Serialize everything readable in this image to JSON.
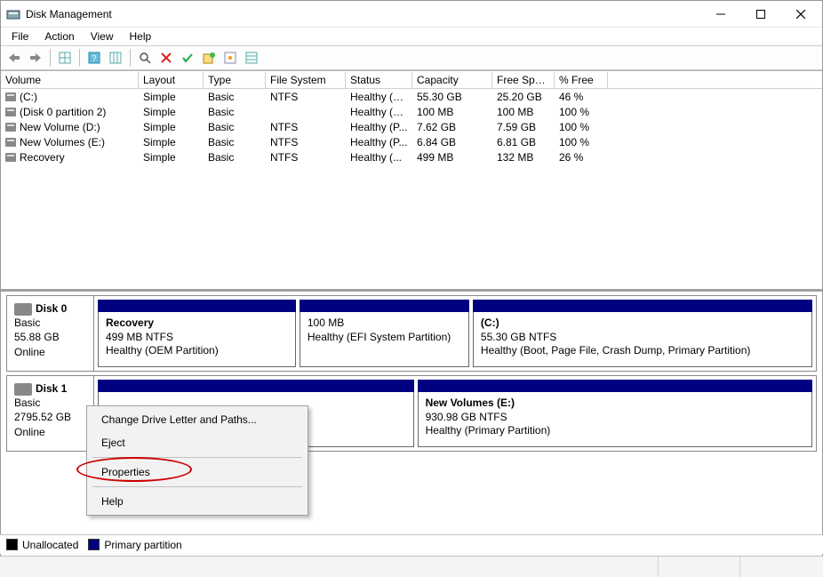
{
  "window": {
    "title": "Disk Management"
  },
  "menu": {
    "file": "File",
    "action": "Action",
    "view": "View",
    "help": "Help"
  },
  "columns": {
    "volume": "Volume",
    "layout": "Layout",
    "type": "Type",
    "fs": "File System",
    "status": "Status",
    "capacity": "Capacity",
    "free": "Free Spa...",
    "pctfree": "% Free"
  },
  "volumes": [
    {
      "name": "(C:)",
      "layout": "Simple",
      "type": "Basic",
      "fs": "NTFS",
      "status": "Healthy (B...",
      "capacity": "55.30 GB",
      "free": "25.20 GB",
      "pctfree": "46 %"
    },
    {
      "name": "(Disk 0 partition 2)",
      "layout": "Simple",
      "type": "Basic",
      "fs": "",
      "status": "Healthy (E...",
      "capacity": "100 MB",
      "free": "100 MB",
      "pctfree": "100 %"
    },
    {
      "name": "New Volume (D:)",
      "layout": "Simple",
      "type": "Basic",
      "fs": "NTFS",
      "status": "Healthy (P...",
      "capacity": "7.62 GB",
      "free": "7.59 GB",
      "pctfree": "100 %"
    },
    {
      "name": "New Volumes (E:)",
      "layout": "Simple",
      "type": "Basic",
      "fs": "NTFS",
      "status": "Healthy (P...",
      "capacity": "6.84 GB",
      "free": "6.81 GB",
      "pctfree": "100 %"
    },
    {
      "name": "Recovery",
      "layout": "Simple",
      "type": "Basic",
      "fs": "NTFS",
      "status": "Healthy (...",
      "capacity": "499 MB",
      "free": "132 MB",
      "pctfree": "26 %"
    }
  ],
  "disks": [
    {
      "label": "Disk 0",
      "kind": "Basic",
      "size": "55.88 GB",
      "state": "Online",
      "parts": [
        {
          "name": "Recovery",
          "line2": "499 MB NTFS",
          "line3": "Healthy (OEM Partition)",
          "flex": 1.4
        },
        {
          "name": "",
          "line2": "100 MB",
          "line3": "Healthy (EFI System Partition)",
          "flex": 1.2
        },
        {
          "name": "(C:)",
          "line2": "55.30 GB NTFS",
          "line3": "Healthy (Boot, Page File, Crash Dump, Primary Partition)",
          "flex": 2.4
        }
      ]
    },
    {
      "label": "Disk 1",
      "kind": "Basic",
      "size": "2795.52 GB",
      "state": "Online",
      "parts": [
        {
          "name": "",
          "line2": "",
          "line3": "",
          "flex": 1
        },
        {
          "name": "New Volumes  (E:)",
          "line2": "930.98 GB NTFS",
          "line3": "Healthy (Primary Partition)",
          "flex": 1.25
        }
      ]
    }
  ],
  "context_menu": {
    "change": "Change Drive Letter and Paths...",
    "eject": "Eject",
    "properties": "Properties",
    "help": "Help"
  },
  "legend": {
    "unallocated": "Unallocated",
    "primary": "Primary partition"
  }
}
